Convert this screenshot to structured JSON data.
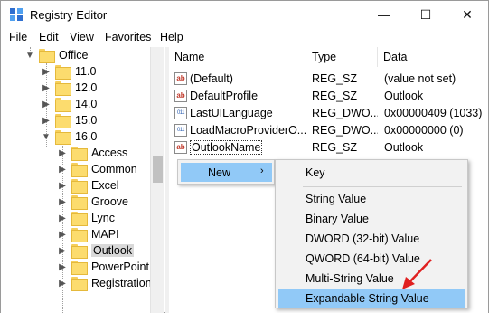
{
  "window": {
    "title": "Registry Editor",
    "controls": {
      "minimize": "—",
      "maximize": "☐",
      "close": "✕"
    }
  },
  "menu": [
    "File",
    "Edit",
    "View",
    "Favorites",
    "Help"
  ],
  "tree": {
    "items": [
      {
        "label": "Office",
        "toggle": "▼"
      },
      {
        "label": "11.0",
        "toggle": "▶"
      },
      {
        "label": "12.0",
        "toggle": "▶"
      },
      {
        "label": "14.0",
        "toggle": "▶"
      },
      {
        "label": "15.0",
        "toggle": "▶"
      },
      {
        "label": "16.0",
        "toggle": "▼"
      },
      {
        "label": "Access",
        "toggle": "▶"
      },
      {
        "label": "Common",
        "toggle": "▶"
      },
      {
        "label": "Excel",
        "toggle": "▶"
      },
      {
        "label": "Groove",
        "toggle": "▶"
      },
      {
        "label": "Lync",
        "toggle": "▶"
      },
      {
        "label": "MAPI",
        "toggle": "▶"
      },
      {
        "label": "Outlook",
        "toggle": "▶",
        "selected": true
      },
      {
        "label": "PowerPoint",
        "toggle": "▶"
      },
      {
        "label": "Registration",
        "toggle": "▶"
      }
    ]
  },
  "list": {
    "headers": {
      "name": "Name",
      "type": "Type",
      "data": "Data"
    },
    "rows": [
      {
        "name": "(Default)",
        "type": "REG_SZ",
        "data": "(value not set)",
        "icon": "ab"
      },
      {
        "name": "DefaultProfile",
        "type": "REG_SZ",
        "data": "Outlook",
        "icon": "ab"
      },
      {
        "name": "LastUILanguage",
        "type": "REG_DWO...",
        "data": "0x00000409 (1033)",
        "icon": "011"
      },
      {
        "name": "LoadMacroProviderO...",
        "type": "REG_DWO...",
        "data": "0x00000000 (0)",
        "icon": "011"
      },
      {
        "name": "OutlookName",
        "type": "REG_SZ",
        "data": "Outlook",
        "icon": "ab"
      }
    ]
  },
  "context_menu": {
    "new_label": "New",
    "new_arrow": "›",
    "submenu": [
      "Key",
      "String Value",
      "Binary Value",
      "DWORD (32-bit) Value",
      "QWORD (64-bit) Value",
      "Multi-String Value",
      "Expandable String Value"
    ]
  },
  "colors": {
    "highlight": "#91c9f7",
    "arrow": "#e02020",
    "folder": "#fcdc6e"
  }
}
